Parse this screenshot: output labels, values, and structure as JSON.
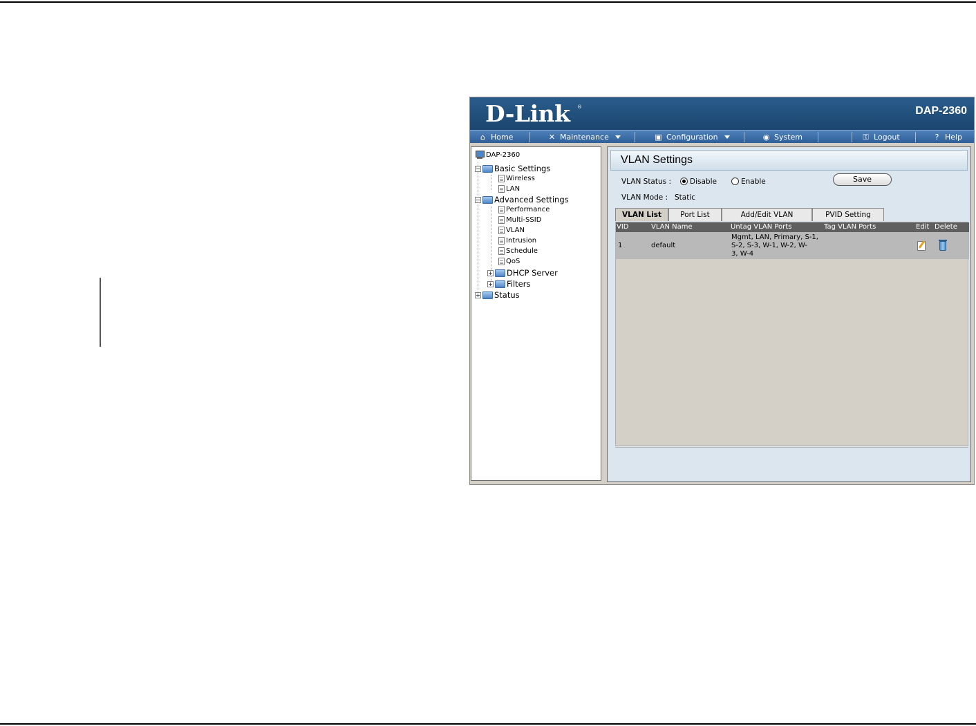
{
  "header": {
    "logo_text": "D-Link",
    "logo_mark": "®",
    "model": "DAP-2360"
  },
  "menu": {
    "items": [
      {
        "label": "Home",
        "icon": "home-icon"
      },
      {
        "label": "Maintenance",
        "icon": "tools-icon",
        "dropdown": true
      },
      {
        "label": "Configuration",
        "icon": "disk-icon",
        "dropdown": true
      },
      {
        "label": "System",
        "icon": "system-icon"
      },
      {
        "label": "Logout",
        "icon": "key-icon"
      },
      {
        "label": "Help",
        "icon": "help-icon"
      }
    ]
  },
  "tree": {
    "root": "DAP-2360",
    "basic_settings": "Basic Settings",
    "wireless": "Wireless",
    "lan": "LAN",
    "advanced_settings": "Advanced Settings",
    "performance": "Performance",
    "multi_ssid": "Multi-SSID",
    "vlan": "VLAN",
    "intrusion": "Intrusion",
    "schedule": "Schedule",
    "qos": "QoS",
    "dhcp_server": "DHCP Server",
    "filters": "Filters",
    "status": "Status"
  },
  "content": {
    "title": "VLAN Settings",
    "vlan_status_label": "VLAN Status  :",
    "disable_label": "Disable",
    "enable_label": "Enable",
    "vlan_status_selected": "Disable",
    "vlan_mode_label": "VLAN Mode  :",
    "vlan_mode_value": "Static",
    "save_label": "Save"
  },
  "tabs": [
    "VLAN List",
    "Port List",
    "Add/Edit VLAN",
    "PVID Setting"
  ],
  "active_tab": "VLAN List",
  "table": {
    "headers": {
      "vid": "VID",
      "name": "VLAN Name",
      "untag": "Untag VLAN Ports",
      "tag": "Tag VLAN Ports",
      "edit": "Edit",
      "delete": "Delete"
    },
    "rows": [
      {
        "vid": "1",
        "name": "default",
        "untag_line1": "Mgmt, LAN, Primary, S-1,",
        "untag_line2": "S-2, S-3, W-1, W-2, W-",
        "untag_line3": "3, W-4",
        "tag": ""
      }
    ]
  }
}
